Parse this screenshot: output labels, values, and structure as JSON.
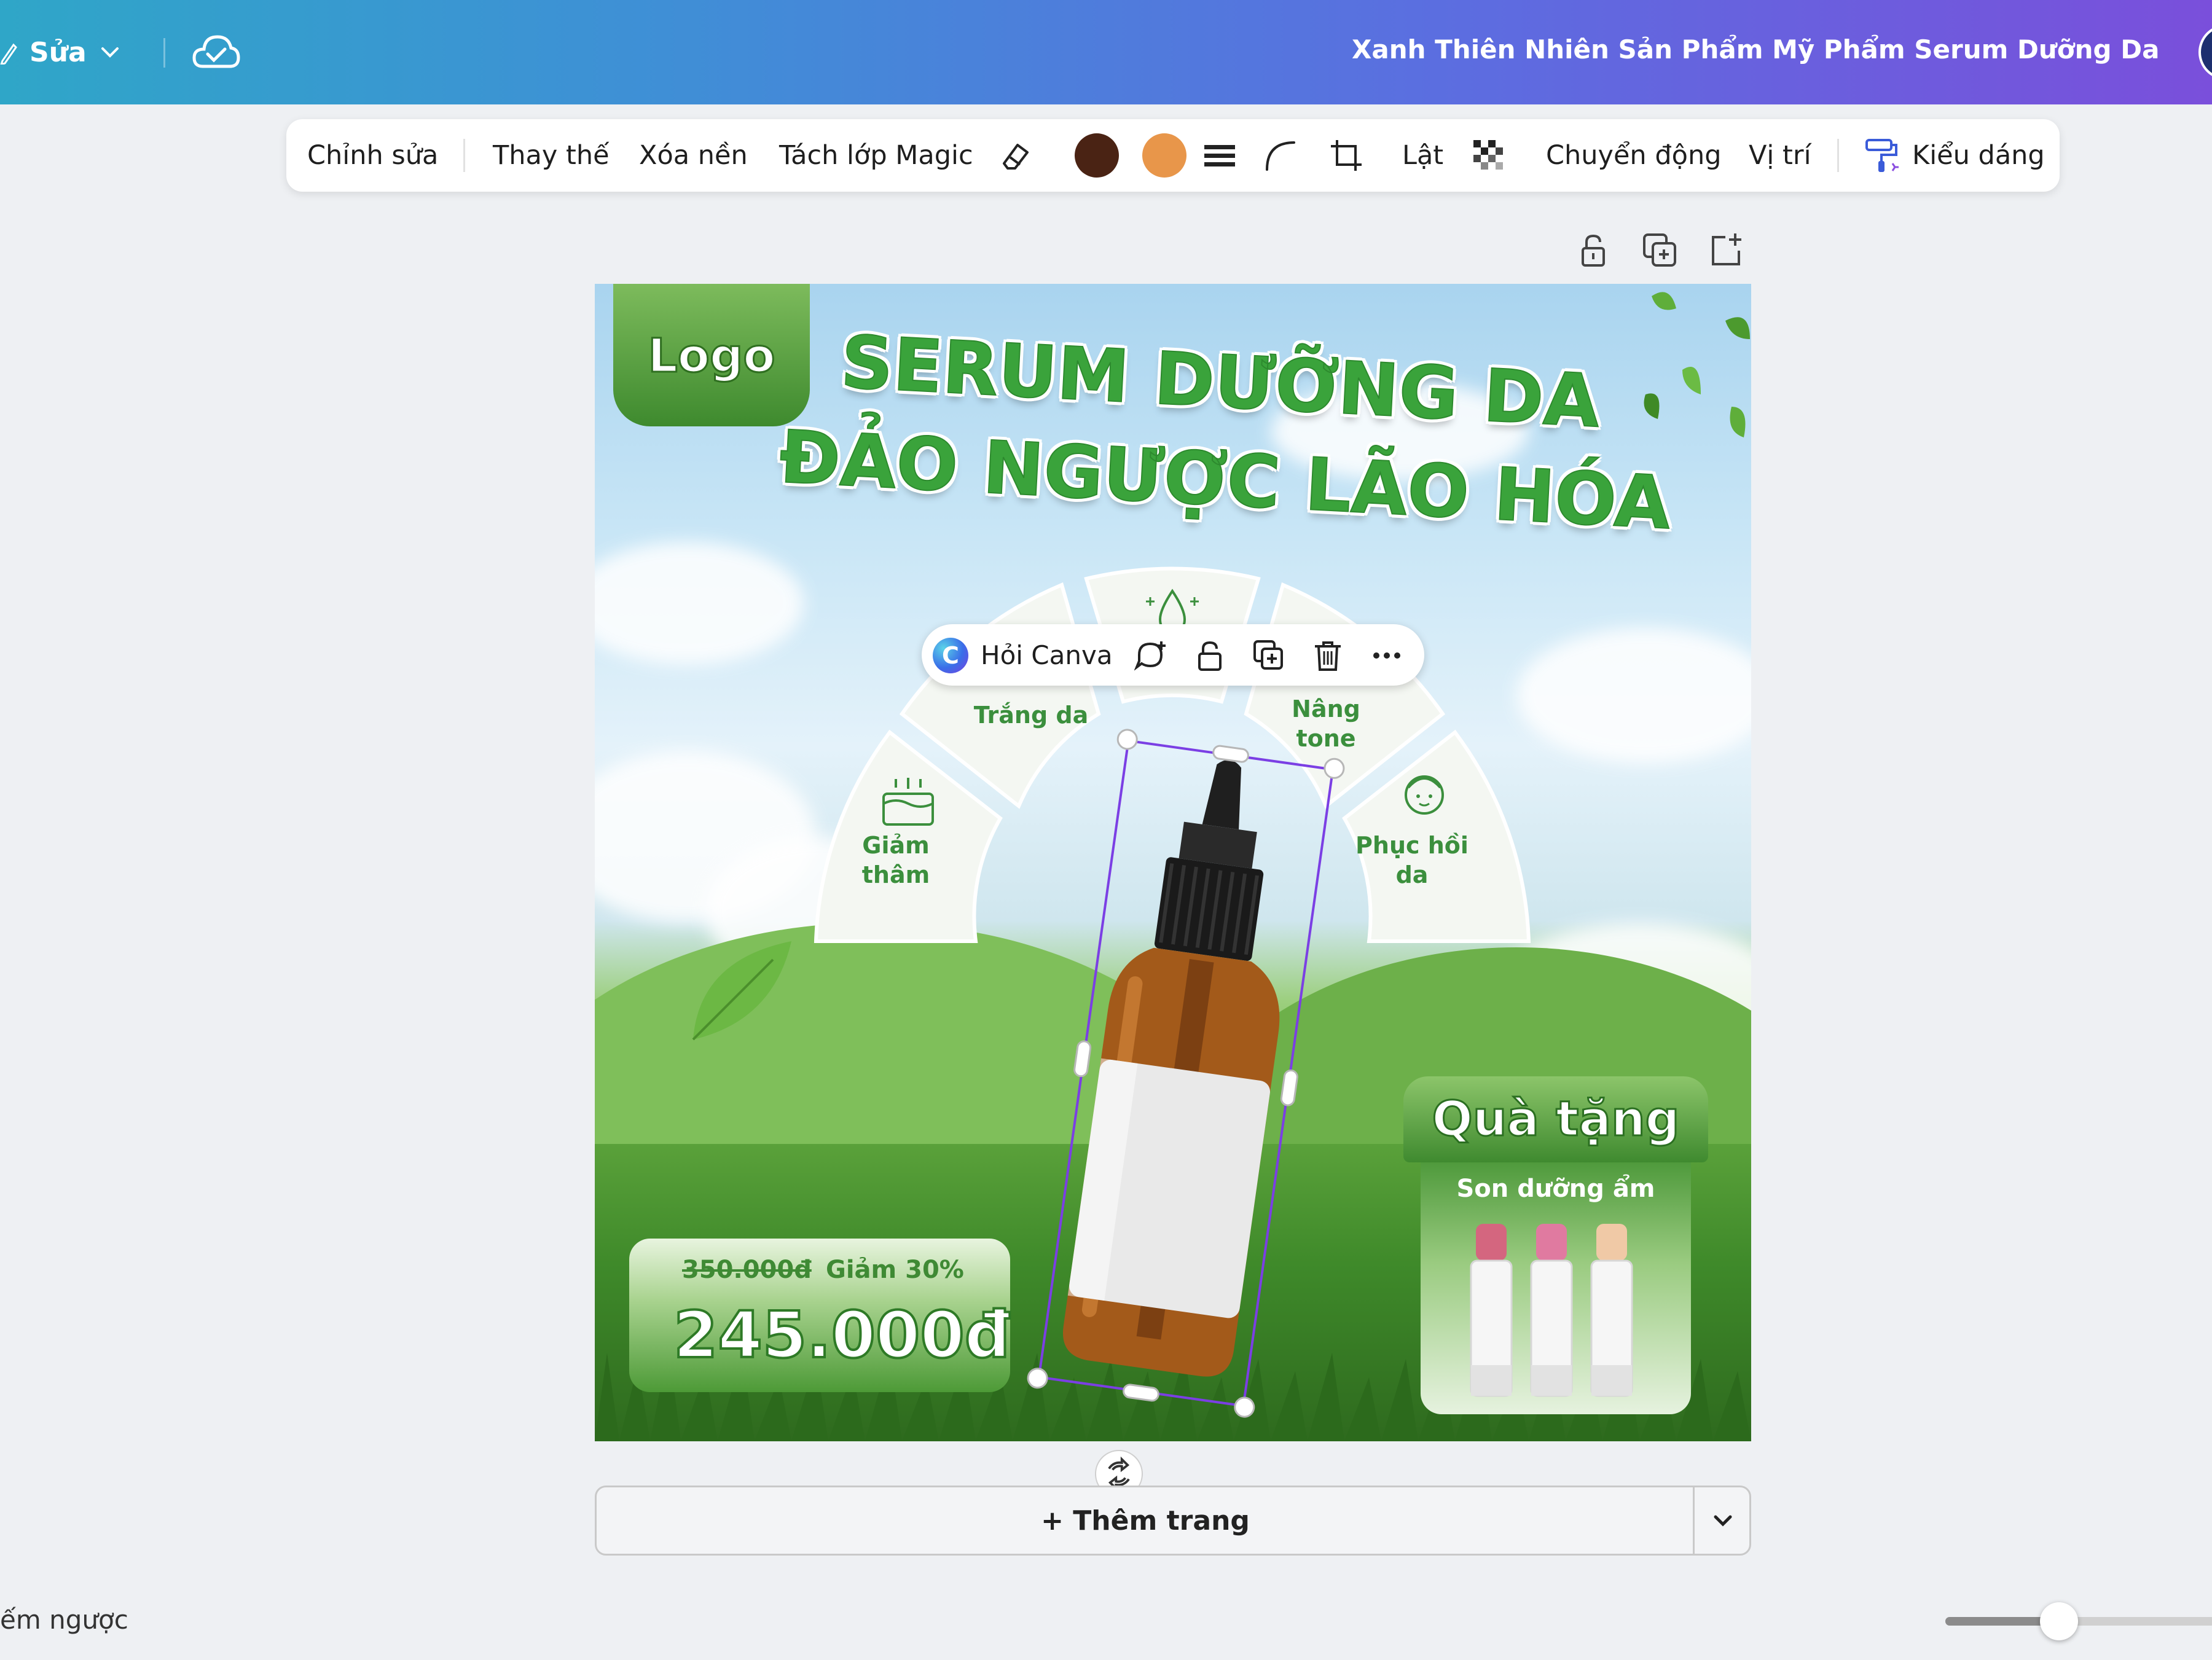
{
  "header": {
    "edit_label": "Sửa",
    "doc_title": "Xanh Thiên Nhiên Sản Phẩm Mỹ Phẩm Serum Dưỡng Da Bà..."
  },
  "toolbar": {
    "edit": "Chỉnh sửa",
    "replace": "Thay thế",
    "remove_bg": "Xóa nền",
    "magic_layer": "Tách lớp Magic",
    "flip": "Lật",
    "animate": "Chuyển động",
    "position": "Vị trí",
    "style": "Kiểu dáng",
    "swatches": [
      "#4a2314",
      "#e8964a"
    ]
  },
  "design": {
    "logo": "Logo",
    "headline_line1": "SERUM DƯỠNG DA",
    "headline_line2": "ĐẢO NGƯỢC LÃO HÓA",
    "benefits": [
      {
        "label": "Giảm\nthâm",
        "icon": "skin-layers-icon"
      },
      {
        "label": "Trắng da",
        "icon": "sparkle-icon"
      },
      {
        "label": "",
        "icon": "water-drop-icon"
      },
      {
        "label": "Nâng\ntone",
        "icon": "sparkle-icon"
      },
      {
        "label": "Phục hồi\nda",
        "icon": "face-icon"
      }
    ],
    "old_price": "350.000đ",
    "discount": "Giảm 30%",
    "new_price": "245.000đ",
    "gift_title": "Quà tặng",
    "gift_sub": "Son dưỡng ẩm",
    "lipstick_colors": [
      "#d4667f",
      "#e07aa0",
      "#f0c9a6"
    ]
  },
  "ask_canva": {
    "label": "Hỏi Canva"
  },
  "footer": {
    "add_page": "+ Thêm trang",
    "notes": "ếm ngược",
    "zoom_fraction": 0.42
  }
}
